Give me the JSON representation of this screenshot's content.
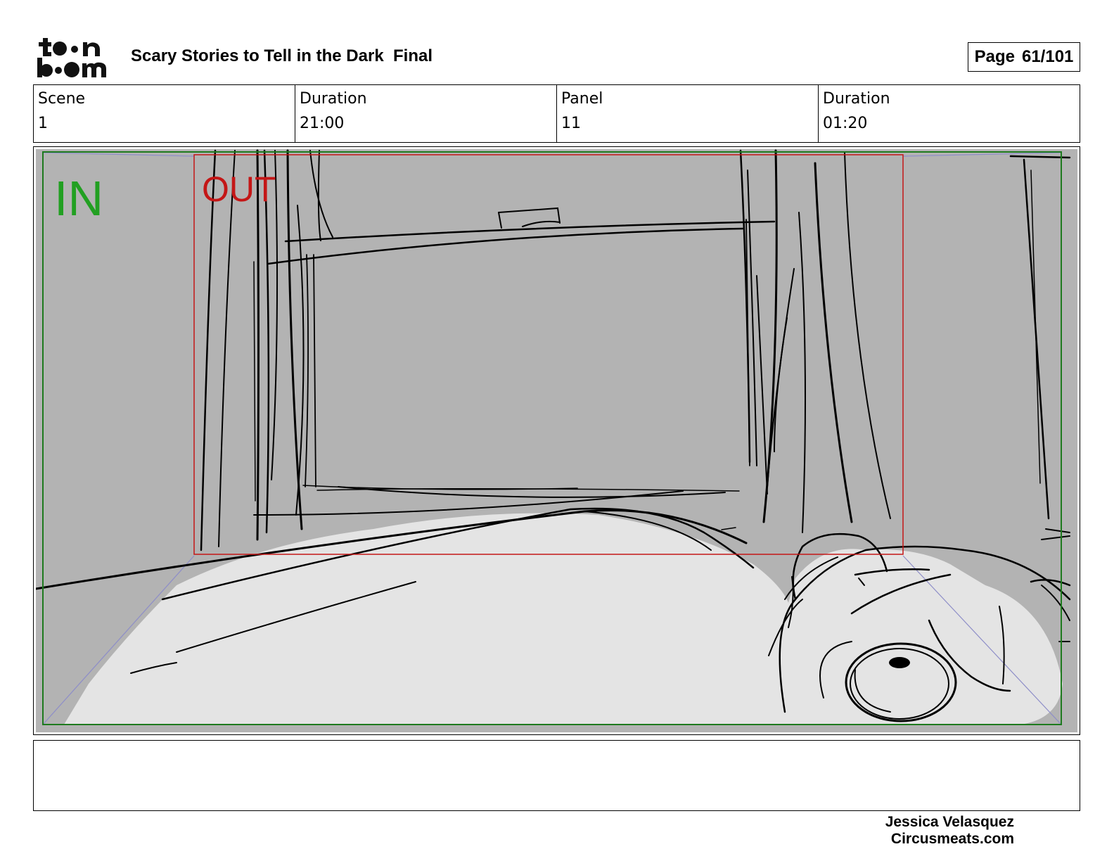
{
  "logo": {
    "line1": "toon",
    "line2": "boom"
  },
  "header": {
    "title": "Scary Stories to Tell in the Dark  Final",
    "page_label": "Page",
    "page_number": "61/101"
  },
  "info": [
    {
      "label": "Scene",
      "value": "1"
    },
    {
      "label": "Duration",
      "value": "21:00"
    },
    {
      "label": "Panel",
      "value": "11"
    },
    {
      "label": "Duration",
      "value": "01:20"
    }
  ],
  "panel": {
    "in_label": "IN",
    "out_label": "OUT",
    "colors": {
      "in_frame": "#1e7a1e",
      "in_text": "#22a022",
      "out_frame": "#c41616",
      "background": "#b3b3b3",
      "blanket": "#e4e4e4"
    }
  },
  "notes": "",
  "credits": {
    "line1": "Jessica Velasquez",
    "line2": "Circusmeats.com"
  }
}
